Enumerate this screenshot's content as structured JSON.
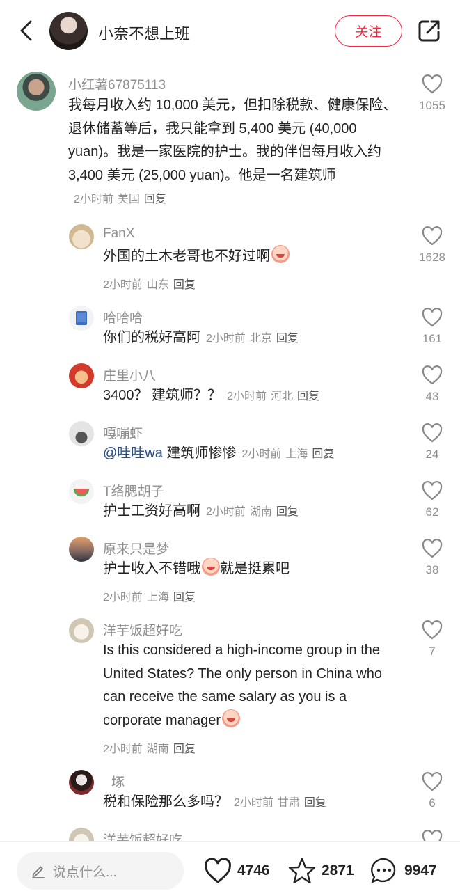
{
  "header": {
    "author_name": "小奈不想上班",
    "follow_label": "关注"
  },
  "comments": [
    {
      "user": "小红薯67875113",
      "text": "我每月收入约 10,000 美元，但扣除税款、健康保险、退休储蓄等后，我只能拿到 5,400 美元 (40,000 yuan)。我是一家医院的护士。我的伴侣每月收入约 3,400 美元 (25,000 yuan)。他是一名建筑师",
      "time": "2小时前",
      "location": "美国",
      "reply": "回复",
      "likes": "1055"
    },
    {
      "user": "FanX",
      "text": "外国的土木老哥也不好过啊",
      "time": "2小时前",
      "location": "山东",
      "reply": "回复",
      "likes": "1628"
    },
    {
      "user": "哈哈哈",
      "text": "你们的税好高阿",
      "time": "2小时前",
      "location": "北京",
      "reply": "回复",
      "likes": "161"
    },
    {
      "user": "庄里小八",
      "text": "3400？ 建筑师？？",
      "time": "2小时前",
      "location": "河北",
      "reply": "回复",
      "likes": "43"
    },
    {
      "user": "嘎嘣虾",
      "mention": "@哇哇wa",
      "text": " 建筑师惨惨",
      "time": "2小时前",
      "location": "上海",
      "reply": "回复",
      "likes": "24"
    },
    {
      "user": "T络腮胡子",
      "text": "护士工资好高啊",
      "time": "2小时前",
      "location": "湖南",
      "reply": "回复",
      "likes": "62"
    },
    {
      "user": "原来只是梦",
      "text": "护士收入不错哦",
      "text_after_emoji": "就是挺累吧",
      "time": "2小时前",
      "location": "上海",
      "reply": "回复",
      "likes": "38"
    },
    {
      "user": "洋芋饭超好吃",
      "text": "Is this considered a high-income group in the United States?   The only person in China who can receive the same salary as you is a corporate manager",
      "time": "2小时前",
      "location": "湖南",
      "reply": "回复",
      "likes": "7"
    },
    {
      "user": "㙇",
      "text": "税和保险那么多吗？",
      "time": "2小时前",
      "location": "甘肃",
      "reply": "回复",
      "likes": "6"
    },
    {
      "user": "洋芋饭超好吃"
    }
  ],
  "bottom_bar": {
    "input_placeholder": "说点什么...",
    "likes": "4746",
    "stars": "2871",
    "comments": "9947"
  },
  "colors": {
    "accent": "#ff2442",
    "secondary_text": "#8f8f8f",
    "mention": "#2b4f80"
  }
}
